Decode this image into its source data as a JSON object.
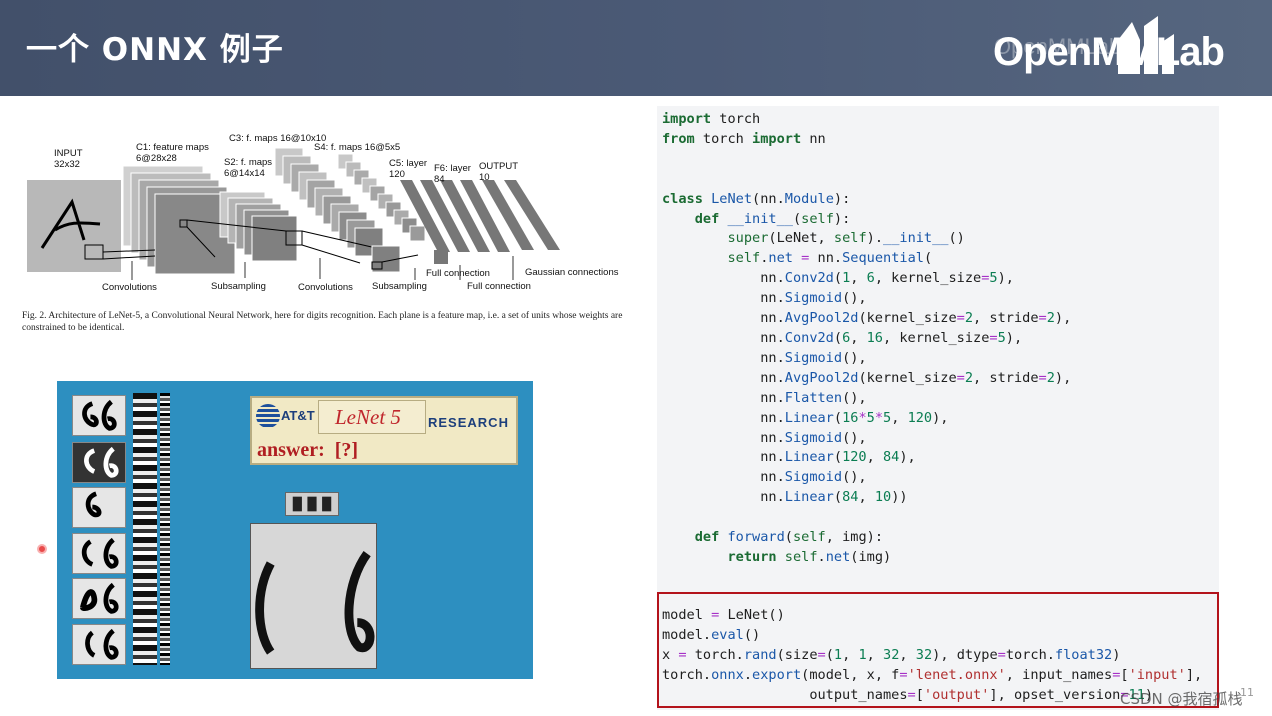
{
  "header": {
    "title": "一个 ONNX 例子",
    "logo_text": "OpenMMLab",
    "logo_ghost_text": "OpenMMLab"
  },
  "diagram": {
    "labels": {
      "input": "INPUT\n32x32",
      "c1": "C1: feature maps\n6@28x28",
      "s2": "S2: f. maps\n6@14x14",
      "c3": "C3: f. maps 16@10x10",
      "s4": "S4: f. maps 16@5x5",
      "c5": "C5: layer\n120",
      "f6": "F6: layer\n84",
      "output": "OUTPUT\n10",
      "convolutions_1": "Convolutions",
      "subsampling_1": "Subsampling",
      "convolutions_2": "Convolutions",
      "subsampling_2": "Subsampling",
      "full_connection_1": "Full connection",
      "full_connection_2": "Full connection",
      "gaussian": "Gaussian connections"
    },
    "caption": "Fig. 2.  Architecture of LeNet-5, a Convolutional Neural Network, here for digits recognition. Each plane is a feature map, i.e. a set of units whose weights are constrained to be identical."
  },
  "demo": {
    "att_label": "AT&T",
    "lenet_label": "LeNet 5",
    "research_label": "RESEARCH",
    "answer_label": "answer:",
    "answer_value": "[?]"
  },
  "code": {
    "lines": [
      "import torch",
      "from torch import nn",
      "",
      "",
      "class LeNet(nn.Module):",
      "    def __init__(self):",
      "        super(LeNet, self).__init__()",
      "        self.net = nn.Sequential(",
      "            nn.Conv2d(1, 6, kernel_size=5),",
      "            nn.Sigmoid(),",
      "            nn.AvgPool2d(kernel_size=2, stride=2),",
      "            nn.Conv2d(6, 16, kernel_size=5),",
      "            nn.Sigmoid(),",
      "            nn.AvgPool2d(kernel_size=2, stride=2),",
      "            nn.Flatten(),",
      "            nn.Linear(16*5*5, 120),",
      "            nn.Sigmoid(),",
      "            nn.Linear(120, 84),",
      "            nn.Sigmoid(),",
      "            nn.Linear(84, 10))",
      "",
      "    def forward(self, img):",
      "        return self.net(img)"
    ],
    "export_lines": [
      "model = LeNet()",
      "model.eval()",
      "x = torch.rand(size=(1, 1, 32, 32), dtype=torch.float32)",
      "torch.onnx.export(model, x, f='lenet.onnx', input_names=['input'],",
      "                  output_names=['output'], opset_version=11)"
    ],
    "highlight_color": "#b3131b"
  },
  "watermark": "CSDN @我宿孤栈",
  "page_number": "11"
}
